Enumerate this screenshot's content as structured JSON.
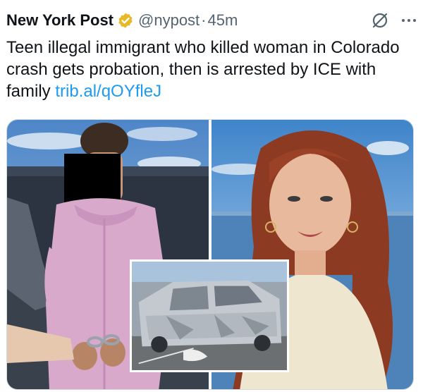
{
  "author": {
    "name": "New York Post",
    "handle": "@nypost",
    "separator": "·",
    "time": "45m",
    "verified_badge_icon": "gold-verified-badge-icon"
  },
  "header_actions": {
    "grok_icon": "grok-icon",
    "more_icon": "more-options-icon"
  },
  "tweet": {
    "text": "Teen illegal immigrant who killed woman in Colorado crash gets probation, then is arrested by ICE with family",
    "link": "trib.al/qOYfleJ"
  },
  "colors": {
    "link": "#1d9bf0",
    "secondary_text": "#536471",
    "badge_gold": "#e8b829"
  }
}
